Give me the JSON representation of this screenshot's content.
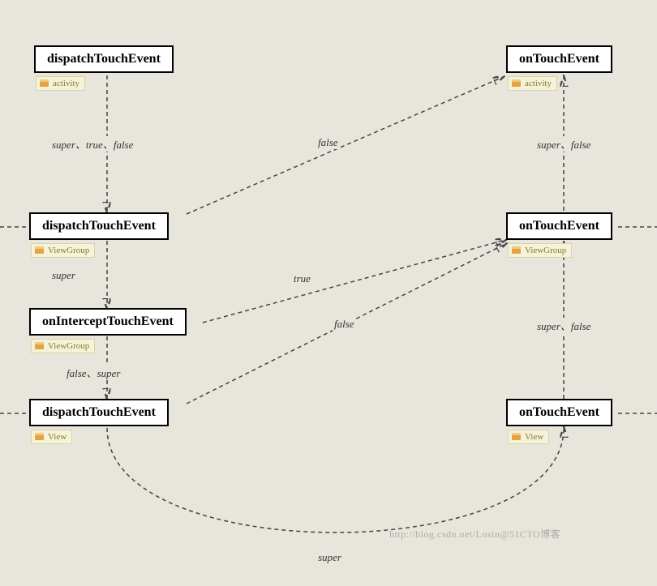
{
  "nodes": {
    "n1": {
      "title": "dispatchTouchEvent",
      "tag": "activity"
    },
    "n2": {
      "title": "onTouchEvent",
      "tag": "activity"
    },
    "n3": {
      "title": "dispatchTouchEvent",
      "tag": "ViewGroup"
    },
    "n4": {
      "title": "onTouchEvent",
      "tag": "ViewGroup"
    },
    "n5": {
      "title": "onInterceptTouchEvent",
      "tag": "ViewGroup"
    },
    "n6": {
      "title": "dispatchTouchEvent",
      "tag": "View"
    },
    "n7": {
      "title": "onTouchEvent",
      "tag": "View"
    }
  },
  "edge_labels": {
    "e1": "super、true、false",
    "e2": "false",
    "e3": "super、false",
    "e4": "super",
    "e5": "true",
    "e6": "false、super",
    "e7": "false",
    "e8": "super、false",
    "e9": "super"
  },
  "watermark": "http://blog.csdn.net/Losin@51CTO博客"
}
